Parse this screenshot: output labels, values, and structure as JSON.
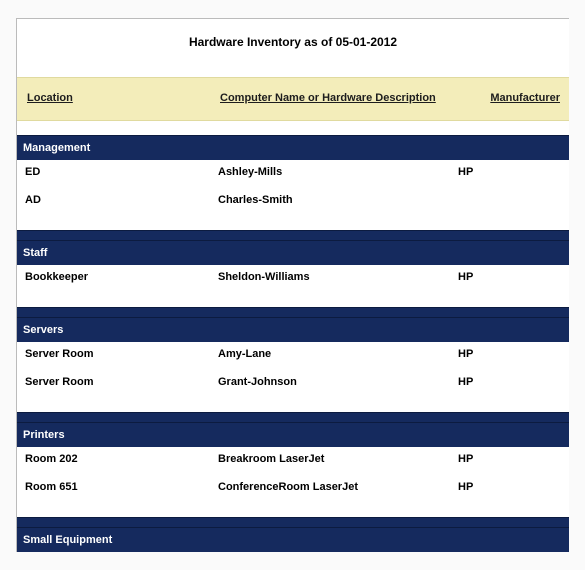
{
  "title": "Hardware Inventory as of 05-01-2012",
  "headers": {
    "location": "Location",
    "name": "Computer Name or Hardware Description",
    "manufacturer": "Manufacturer"
  },
  "sections": [
    {
      "label": "Management",
      "rows": [
        {
          "location": "ED",
          "name": "Ashley-Mills",
          "manufacturer": "HP"
        },
        {
          "location": "AD",
          "name": "Charles-Smith",
          "manufacturer": ""
        }
      ]
    },
    {
      "label": "Staff",
      "rows": [
        {
          "location": "Bookkeeper",
          "name": "Sheldon-Williams",
          "manufacturer": "HP"
        }
      ]
    },
    {
      "label": "Servers",
      "rows": [
        {
          "location": "Server Room",
          "name": "Amy-Lane",
          "manufacturer": "HP"
        },
        {
          "location": "Server Room",
          "name": "Grant-Johnson",
          "manufacturer": "HP"
        }
      ]
    },
    {
      "label": "Printers",
      "rows": [
        {
          "location": "Room 202",
          "name": "Breakroom LaserJet",
          "manufacturer": "HP"
        },
        {
          "location": "Room 651",
          "name": "ConferenceRoom LaserJet",
          "manufacturer": "HP"
        }
      ]
    },
    {
      "label": "Small Equipment",
      "rows": []
    }
  ]
}
